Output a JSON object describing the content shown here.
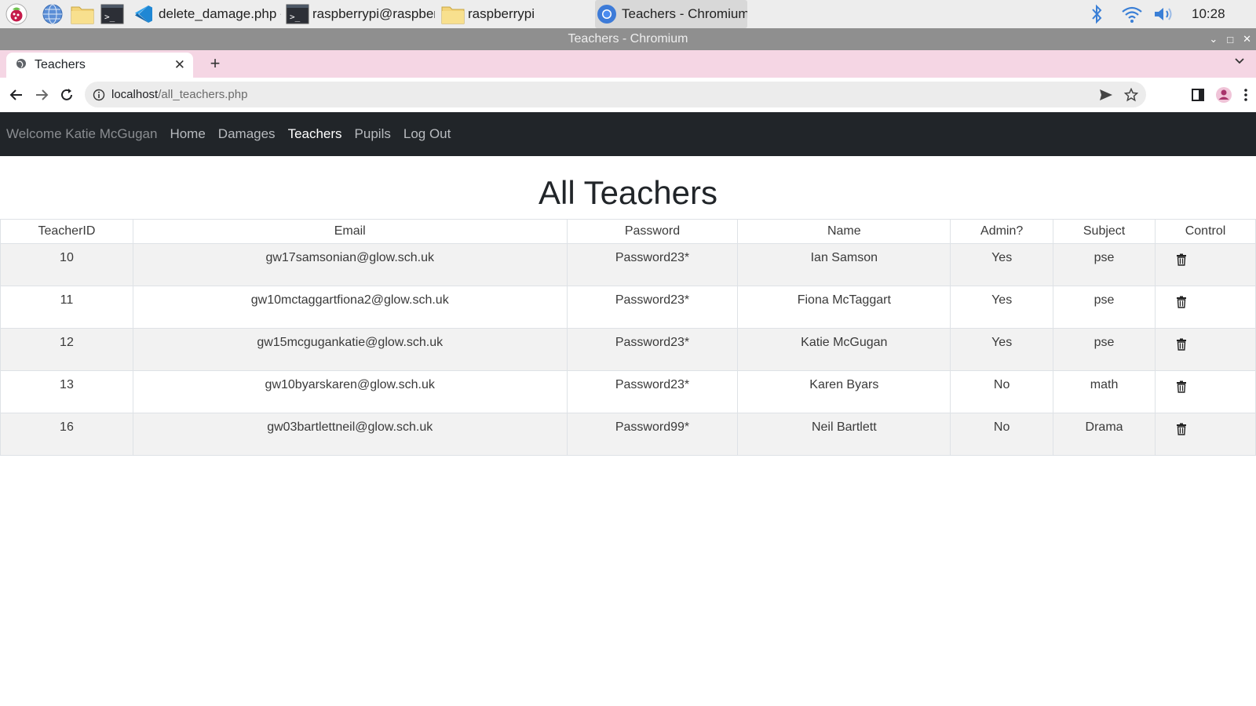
{
  "taskbar": {
    "windows": [
      {
        "label": "delete_damage.php - ...",
        "icon": "vscode-icon"
      },
      {
        "label": "raspberrypi@raspber...",
        "icon": "terminal-icon"
      },
      {
        "label": "raspberrypi",
        "icon": "folder-icon"
      },
      {
        "label": "Teachers - Chromium",
        "icon": "chromium-icon"
      }
    ],
    "clock": "10:28"
  },
  "window": {
    "title": "Teachers - Chromium"
  },
  "browser": {
    "tab_title": "Teachers",
    "url_host": "localhost",
    "url_path": "/all_teachers.php"
  },
  "site": {
    "welcome": "Welcome Katie McGugan",
    "nav": [
      {
        "label": "Home",
        "active": false
      },
      {
        "label": "Damages",
        "active": false
      },
      {
        "label": "Teachers",
        "active": true
      },
      {
        "label": "Pupils",
        "active": false
      },
      {
        "label": "Log Out",
        "active": false
      }
    ],
    "heading": "All Teachers"
  },
  "table": {
    "headers": [
      "TeacherID",
      "Email",
      "Password",
      "Name",
      "Admin?",
      "Subject",
      "Control"
    ],
    "rows": [
      {
        "id": "10",
        "email": "gw17samsonian@glow.sch.uk",
        "password": "Password23*",
        "name": "Ian Samson",
        "admin": "Yes",
        "subject": "pse"
      },
      {
        "id": "11",
        "email": "gw10mctaggartfiona2@glow.sch.uk",
        "password": "Password23*",
        "name": "Fiona McTaggart",
        "admin": "Yes",
        "subject": "pse"
      },
      {
        "id": "12",
        "email": "gw15mcgugankatie@glow.sch.uk",
        "password": "Password23*",
        "name": "Katie McGugan",
        "admin": "Yes",
        "subject": "pse"
      },
      {
        "id": "13",
        "email": "gw10byarskaren@glow.sch.uk",
        "password": "Password23*",
        "name": "Karen Byars",
        "admin": "No",
        "subject": "math"
      },
      {
        "id": "16",
        "email": "gw03bartlettneil@glow.sch.uk",
        "password": "Password99*",
        "name": "Neil Bartlett",
        "admin": "No",
        "subject": "Drama"
      }
    ]
  }
}
